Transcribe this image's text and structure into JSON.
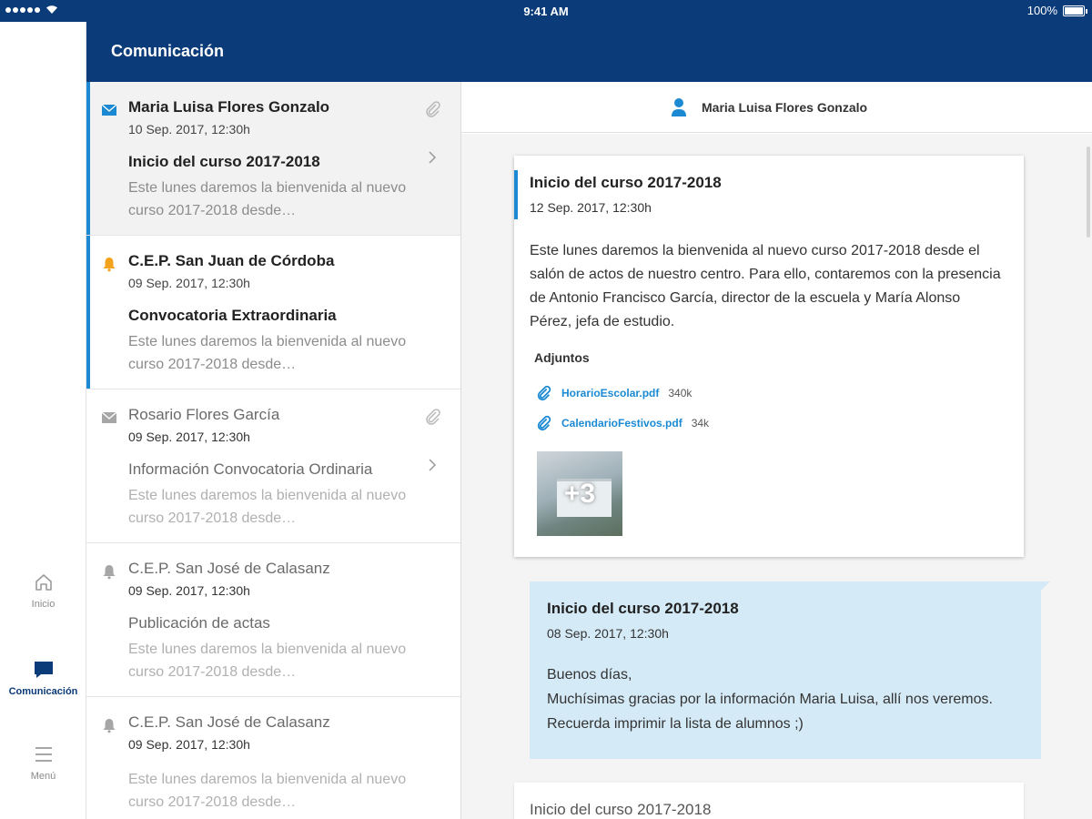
{
  "status_bar": {
    "time": "9:41 AM",
    "battery": "100%"
  },
  "header": {
    "title": "Comunicación"
  },
  "rail": {
    "items": [
      {
        "label": "Inicio",
        "icon": "home-icon"
      },
      {
        "label": "Comunicación",
        "icon": "chat-icon"
      },
      {
        "label": "Menú",
        "icon": "menu-icon"
      }
    ]
  },
  "messages": [
    {
      "sender": "Maria Luisa Flores Gonzalo",
      "date": "10 Sep. 2017,  12:30h",
      "subject": "Inicio del curso 2017-2018",
      "preview": "Este lunes daremos la bienvenida al nuevo curso 2017-2018 desde…",
      "icon": "envelope-icon"
    },
    {
      "sender": "C.E.P. San Juan de Córdoba",
      "date": "09 Sep. 2017,  12:30h",
      "subject": "Convocatoria Extraordinaria",
      "preview": "Este lunes daremos la bienvenida al nuevo curso 2017-2018 desde…",
      "icon": "bell-icon"
    },
    {
      "sender": "Rosario Flores García",
      "date": "09 Sep. 2017,  12:30h",
      "subject": "Información Convocatoria Ordinaria",
      "preview": "Este lunes daremos la bienvenida al nuevo curso 2017-2018 desde…",
      "icon": "envelope-icon"
    },
    {
      "sender": "C.E.P. San José de Calasanz",
      "date": "09 Sep. 2017,  12:30h",
      "subject": "Publicación de actas",
      "preview": "Este lunes daremos la bienvenida al nuevo curso 2017-2018 desde…",
      "icon": "bell-icon"
    },
    {
      "sender": "C.E.P. San José de Calasanz",
      "date": "09 Sep. 2017,  12:30h",
      "subject": "",
      "preview": "Este lunes daremos la bienvenida al nuevo curso 2017-2018 desde…",
      "icon": "bell-icon"
    }
  ],
  "conversation": {
    "contact": "Maria Luisa Flores Gonzalo",
    "message": {
      "subject": "Inicio del curso 2017-2018",
      "date": "12 Sep. 2017, 12:30h",
      "body": "Este lunes daremos la bienvenida al nuevo curso 2017-2018 desde el salón de actos de nuestro centro. Para ello, contaremos con la presencia de Antonio Francisco García, director de la escuela y María Alonso Pérez, jefa de estudio.",
      "attachments_title": "Adjuntos",
      "attachments": [
        {
          "name": "HorarioEscolar.pdf",
          "size": "340k"
        },
        {
          "name": "CalendarioFestivos.pdf",
          "size": "34k"
        }
      ],
      "images_more": "+3"
    },
    "reply": {
      "subject": "Inicio del curso 2017-2018",
      "date": "08 Sep. 2017, 12:30h",
      "body": "Buenos días,\nMuchísimas gracias por la información Maria Luisa, allí nos veremos. Recuerda imprimir la lista de alumnos ;)"
    },
    "next": {
      "subject": "Inicio del curso 2017-2018"
    }
  },
  "colors": {
    "brand": "#0b3b78",
    "accent": "#1b8ad3",
    "unread_bell": "#f2a21b",
    "reply_bg": "#d5eaf7"
  }
}
